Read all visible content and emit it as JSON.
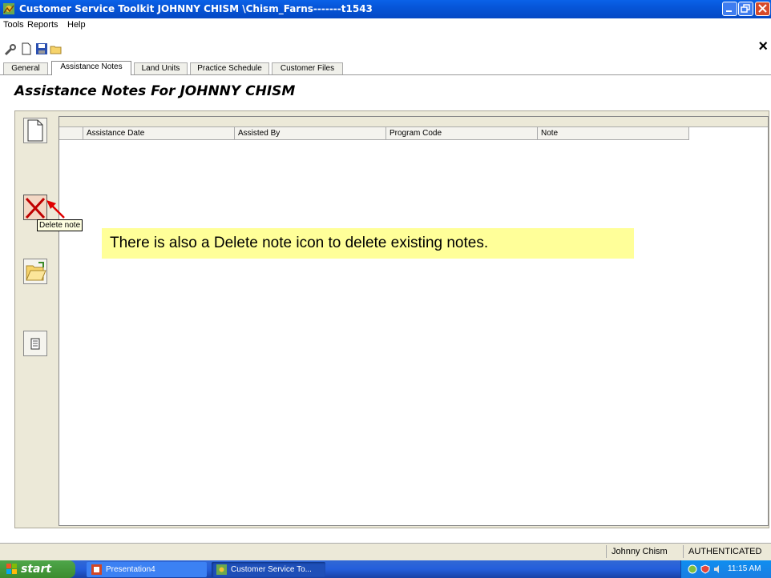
{
  "window": {
    "title": "Customer Service Toolkit     JOHNNY CHISM     \\Chism_Farns-------t1543",
    "icon": "app-icon"
  },
  "menu": {
    "items": [
      "Tools",
      "Reports",
      "Help"
    ]
  },
  "toolbar": {
    "icons": [
      "wrench-icon",
      "new-document-icon",
      "save-icon",
      "open-folder-icon"
    ],
    "close_label": "×"
  },
  "tabs": [
    "General",
    "Assistance Notes",
    "Land Units",
    "Practice Schedule",
    "Customer Files"
  ],
  "active_tab": "Assistance Notes",
  "heading": "Assistance Notes For   JOHNNY CHISM",
  "grid": {
    "columns": [
      "Assistance Date",
      "Assisted By",
      "Program Code",
      "Note"
    ],
    "rows": []
  },
  "sidebar": {
    "buttons": [
      "new-note-icon",
      "delete-note-icon",
      "open-note-icon",
      "print-note-icon"
    ],
    "tooltip": "Delete note"
  },
  "callout": "There is also a Delete note icon to delete existing notes.",
  "status": {
    "user": "Johnny Chism",
    "auth": "AUTHENTICATED"
  },
  "taskbar": {
    "start_label": "start",
    "items": [
      "Presentation4",
      "Customer Service To..."
    ],
    "clock": "11:15 AM"
  },
  "colors": {
    "titlebar": "#0655d8",
    "callout": "#ffff99",
    "taskbar": "#245edb",
    "start": "#3c8c2e"
  }
}
